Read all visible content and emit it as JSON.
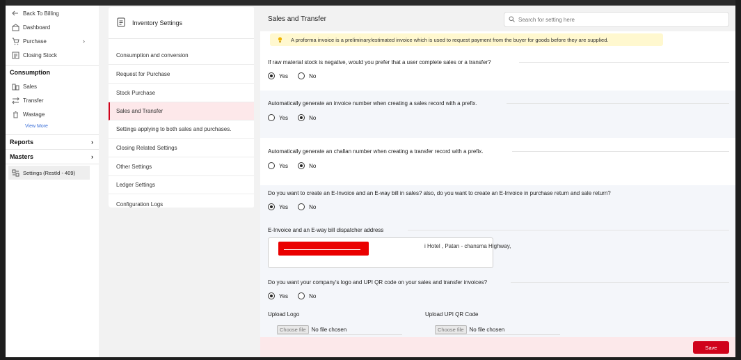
{
  "sidebar": {
    "back": "Back To Billing",
    "dashboard": "Dashboard",
    "purchase": "Purchase",
    "closing_stock": "Closing Stock",
    "consumption_header": "Consumption",
    "sales": "Sales",
    "transfer": "Transfer",
    "wastage": "Wastage",
    "view_more": "View More",
    "reports": "Reports",
    "masters": "Masters",
    "settings": "Settings (RestId - 409)"
  },
  "middle": {
    "title": "Inventory Settings",
    "items": [
      "Consumption and conversion",
      "Request for Purchase",
      "Stock Purchase",
      "Sales and Transfer",
      "Settings applying to both sales and purchases.",
      "Closing Related Settings",
      "Other Settings",
      "Ledger Settings",
      "Configuration Logs"
    ]
  },
  "right": {
    "title": "Sales and Transfer",
    "search_placeholder": "Search for setting here",
    "notice": "A proforma invoice is a preliminary/estimated invoice which is used to request payment from the buyer for goods before they are supplied.",
    "yes": "Yes",
    "no": "No",
    "q1": "If raw material stock is negative, would you prefer that a user complete sales or a transfer?",
    "q2": "Automatically generate an invoice number when creating a sales record with a prefix.",
    "q3": "Automatically generate an challan number when creating a transfer record with a prefix.",
    "q4": "Do you want to create an E-Invoice and an E-way bill in sales? also, do you want to create an E-Invoice in purchase return and sale return?",
    "q5_label": "E-Invoice and an E-way bill dispatcher address",
    "address_visible": "i Hotel , Patan - chansma Highway,",
    "q6": "Do you want your company's logo and UPI QR code on your sales and transfer invoices?",
    "upload_logo": "Upload Logo",
    "upload_qr": "Upload UPI QR Code",
    "choose_file": "Choose file",
    "no_file": "No file chosen",
    "save": "Save"
  }
}
